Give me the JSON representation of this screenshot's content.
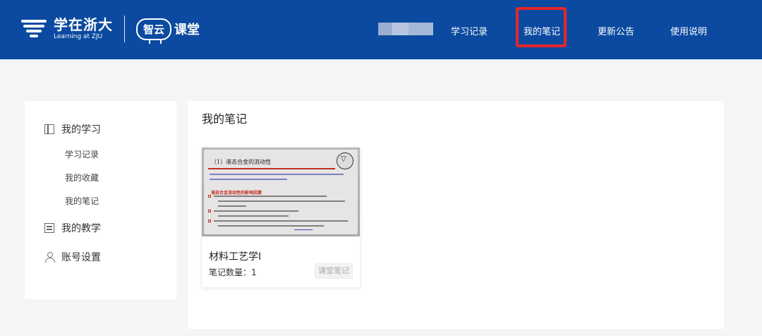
{
  "header": {
    "brand_cn": "学在浙大",
    "brand_en": "Learning at ZJU",
    "product_badge": "智云",
    "product_name": "课堂",
    "nav": [
      {
        "label": "学习记录"
      },
      {
        "label": "我的笔记",
        "active": true
      },
      {
        "label": "更新公告"
      },
      {
        "label": "使用说明"
      }
    ],
    "colors": {
      "bar": "#0b4aa0",
      "highlight": "#e8262b"
    }
  },
  "sidebar": {
    "groups": [
      {
        "label": "我的学习",
        "icon": "notebook-icon"
      },
      {
        "label": "我的教学",
        "icon": "list-icon"
      },
      {
        "label": "账号设置",
        "icon": "user-icon"
      }
    ],
    "sub_items": [
      {
        "label": "学习记录"
      },
      {
        "label": "我的收藏"
      },
      {
        "label": "我的笔记"
      }
    ]
  },
  "main": {
    "title": "我的笔记",
    "cards": [
      {
        "title": "材料工艺学Ⅰ",
        "count_label": "笔记数量：",
        "count": "1",
        "tag": "课堂笔记",
        "slide": {
          "heading": "（1）液态合金的流动性",
          "red_heading": "液态合金流动性的影响因素"
        }
      }
    ]
  }
}
